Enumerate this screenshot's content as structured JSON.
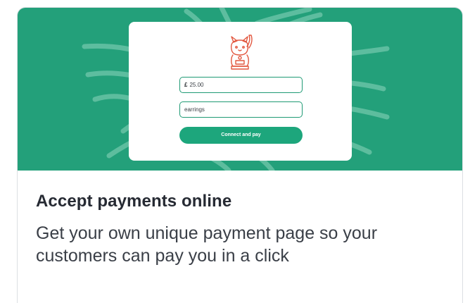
{
  "banner": {
    "colors": {
      "background": "#23a07a",
      "accent": "#1da67c",
      "mascot": "#e2573f"
    },
    "mascot_icon": "lucky-cat-icon"
  },
  "payment_form": {
    "currency_symbol": "£",
    "amount_value": "25.00",
    "description_value": "earrings",
    "pay_button_label": "Connect and pay"
  },
  "content": {
    "title": "Accept payments online",
    "description": "Get your own unique payment page so your customers can pay you in a click"
  }
}
